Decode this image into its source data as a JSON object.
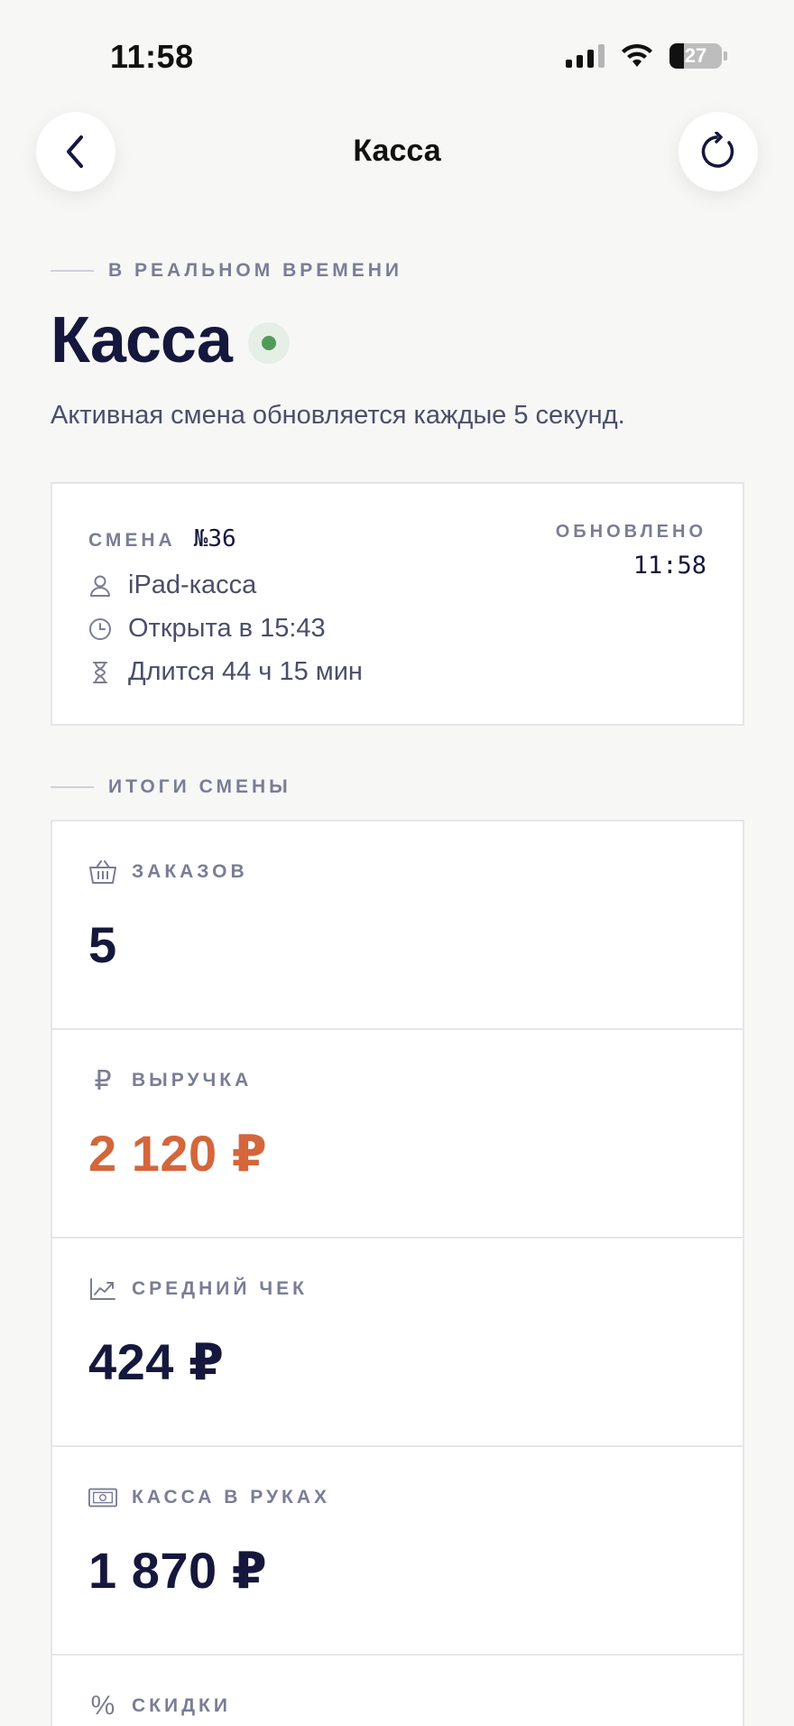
{
  "status_bar": {
    "time": "11:58",
    "battery": "27"
  },
  "nav": {
    "title": "Касса"
  },
  "realtime": {
    "eyebrow": "В РЕАЛЬНОМ ВРЕМЕНИ"
  },
  "page": {
    "title": "Касса",
    "subtitle": "Активная смена обновляется каждые 5 секунд."
  },
  "shift": {
    "label": "СМЕНА",
    "number": "№36",
    "updated_label": "ОБНОВЛЕНО",
    "updated_time": "11:58",
    "device": "iPad-касса",
    "opened": "Открыта в 15:43",
    "duration": "Длится 44 ч 15 мин"
  },
  "totals": {
    "eyebrow": "ИТОГИ СМЕНЫ"
  },
  "stats": [
    {
      "label": "ЗАКАЗОВ",
      "value": "5",
      "icon": "basket-icon"
    },
    {
      "label": "ВЫРУЧКА",
      "value": "2 120 ₽",
      "icon": "ruble-icon",
      "color": "#d4663c"
    },
    {
      "label": "СРЕДНИЙ ЧЕК",
      "value": "424 ₽",
      "icon": "trend-icon"
    },
    {
      "label": "КАССА В РУКАХ",
      "value": "1 870 ₽",
      "icon": "banknote-icon"
    },
    {
      "label": "СКИДКИ",
      "icon": "percent-icon"
    }
  ],
  "icon_glyphs": {
    "ruble": "₽",
    "percent": "%"
  }
}
